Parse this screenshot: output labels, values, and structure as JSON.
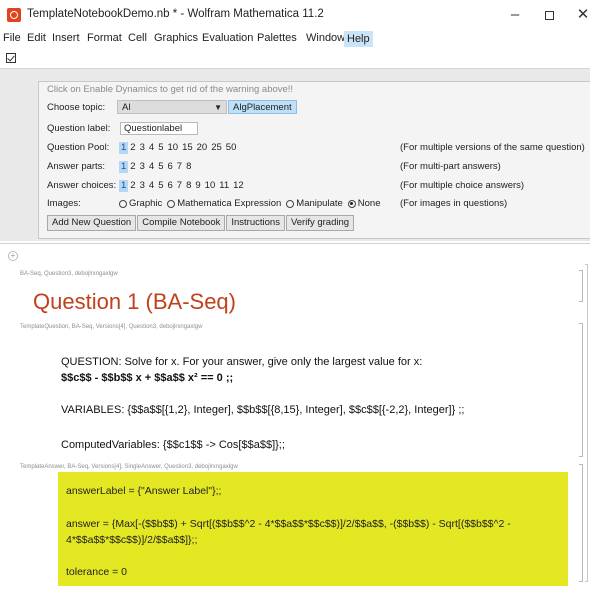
{
  "window": {
    "title": "TemplateNotebookDemo.nb * - Wolfram Mathematica 11.2",
    "minimize": "–",
    "close": "✕"
  },
  "menu": [
    "File",
    "Edit",
    "Insert",
    "Format",
    "Cell",
    "Graphics",
    "Evaluation",
    "Palettes",
    "Window",
    "Help"
  ],
  "panel": {
    "warning": "Click on Enable Dynamics to get rid of the warning above!!",
    "topic_label": "Choose topic:",
    "topic_value": "Al",
    "topic_arrow": "▼",
    "alg_button": "AlgPlacement",
    "qlabel_label": "Question label:",
    "qlabel_value": "Questionlabel",
    "pool_label": "Question Pool:",
    "pool_options": [
      "1",
      "2",
      "3",
      "4",
      "5",
      "10",
      "15",
      "20",
      "25",
      "50"
    ],
    "pool_hint": "(For multiple versions of the same question)",
    "parts_label": "Answer parts:",
    "parts_options": [
      "1",
      "2",
      "3",
      "4",
      "5",
      "6",
      "7",
      "8"
    ],
    "parts_hint": "(For multi-part answers)",
    "choices_label": "Answer choices:",
    "choices_options": [
      "1",
      "2",
      "3",
      "4",
      "5",
      "6",
      "7",
      "8",
      "9",
      "10",
      "11",
      "12"
    ],
    "choices_hint": "(For multiple choice answers)",
    "images_label": "Images:",
    "images_options": [
      "Graphic",
      "Mathematica Expression",
      "Manipulate",
      "None"
    ],
    "images_hint": "(For images in questions)",
    "buttons": [
      "Add New Question",
      "Compile Notebook",
      "Instructions",
      "Verify grading"
    ]
  },
  "notebook": {
    "plus": "+",
    "tag1": "BA-Seq, Question3, debojlrxngaxlgw",
    "heading": "Question 1 (BA-Seq)",
    "tag2": "TemplateQuestion, BA-Seq, Versions[4], Question3, debojlrxngaxlgw",
    "question_text": "QUESTION:  Solve for x.  For your answer, give only the largest value for x:",
    "question_math": "$$c$$ - $$b$$ x + $$a$$ x² == 0 ;;",
    "variables": "VARIABLES: {$$a$$[{1,2}, Integer], $$b$$[{8,15}, Integer], $$c$$[{-2,2}, Integer]} ;;",
    "computed": "ComputedVariables: {$$c1$$ -> Cos[$$a$$]};;",
    "tag3": "TemplateAnswer, BA-Seq, Versions[4], SingleAnswer, Question3, debojlrxngaxlgw",
    "answer_label": "answerLabel = {\"Answer Label\"};;",
    "answer_line1": "answer = {Max[-($$b$$) + Sqrt[($$b$$^2 - 4*$$a$$*$$c$$)]/2/$$a$$, -($$b$$) - Sqrt[($$b$$^2 -",
    "answer_line2": "4*$$a$$*$$c$$)]/2/$$a$$]};;",
    "tolerance": "tolerance = 0"
  },
  "colors": {
    "heading": "#c0411b",
    "answer_bg": "#e4e823",
    "selected": "#b3d7f5",
    "menu_active": "#cce4f7"
  }
}
